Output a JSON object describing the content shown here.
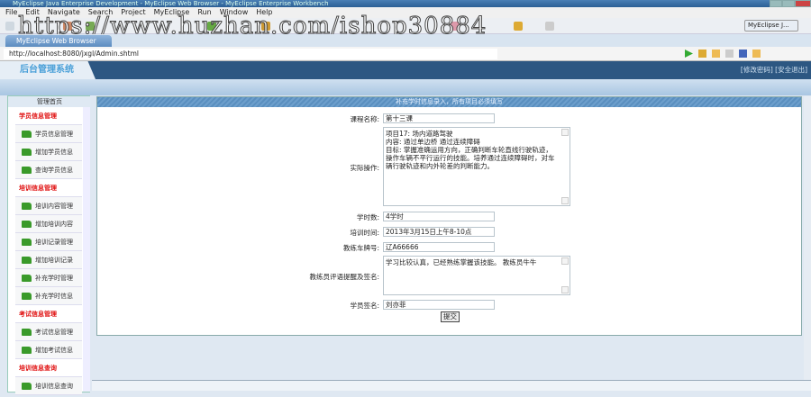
{
  "window": {
    "title": "MyEclipse Java Enterprise Development - MyEclipse Web Browser - MyEclipse Enterprise Workbench"
  },
  "menu": [
    "File",
    "Edit",
    "Navigate",
    "Search",
    "Project",
    "MyEclipse",
    "Run",
    "Window",
    "Help"
  ],
  "watermark": "https://www.huzhan.com/ishop30884",
  "perspective": "MyEclipse J...",
  "tab": {
    "label": "MyEclipse Web Browser"
  },
  "address": "http://localhost:8080/jxgl/Admin.shtml",
  "header": {
    "logo": "后台管理系统",
    "links": "[修改密码] [安全退出]"
  },
  "sidebar": {
    "home": "管理首页",
    "items": [
      {
        "label": "学员信息管理",
        "type": "cat"
      },
      {
        "label": "学员信息管理",
        "type": "item"
      },
      {
        "label": "增加学员信息",
        "type": "item"
      },
      {
        "label": "查询学员信息",
        "type": "item"
      },
      {
        "label": "培训信息管理",
        "type": "cat"
      },
      {
        "label": "培训内容管理",
        "type": "item"
      },
      {
        "label": "增加培训内容",
        "type": "item"
      },
      {
        "label": "培训记录管理",
        "type": "item"
      },
      {
        "label": "增加培训记录",
        "type": "item"
      },
      {
        "label": "补充学时管理",
        "type": "item"
      },
      {
        "label": "补充学时信息",
        "type": "item"
      },
      {
        "label": "考试信息管理",
        "type": "cat"
      },
      {
        "label": "考试信息管理",
        "type": "item"
      },
      {
        "label": "增加考试信息",
        "type": "item"
      },
      {
        "label": "培训信息查询",
        "type": "cat"
      },
      {
        "label": "培训信息查询",
        "type": "item"
      }
    ]
  },
  "form": {
    "heading": "补充学时信息录入，所有项目必须填写",
    "course_label": "课程名称:",
    "course": "第十三课",
    "practice_label": "实际操作:",
    "practice": "项目17: 场内道路驾驶\n内容: 通过单边桥 通过连续障碍\n目标: 掌握准确运用方向，正确判断车轮直线行驶轨迹，操作车辆不平行运行的技能。培养通过连续障碍时，对车辆行驶轨迹和内外轮差的判断能力。",
    "hours_label": "学时数:",
    "hours": "4学时",
    "time_label": "培训时间:",
    "time": "2013年3月15日上午8-10点",
    "plate_label": "教练车牌号:",
    "plate": "辽A66666",
    "comment_label": "教练员评语提醒及签名:",
    "comment": "学习比较认真，已经熟练掌握该技能。 教练员牛牛",
    "student_label": "学员签名:",
    "student": "刘亦菲",
    "submit": "提交"
  }
}
